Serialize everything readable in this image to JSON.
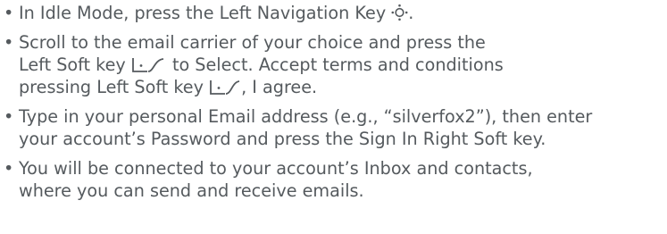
{
  "instructions": [
    {
      "bullet": "•",
      "line1_before": "In Idle Mode, press the Left Navigation Key ",
      "line1_icon": "navigation-key-icon",
      "line1_after": "."
    },
    {
      "bullet": "•",
      "line1": "Scroll to the email carrier of your choice and press the",
      "line2_before": "Left Soft key ",
      "line2_icon": "left-soft-key-icon",
      "line2_after": " to Select. Accept terms and conditions",
      "line3_before": "pressing Left Soft key ",
      "line3_icon": "left-soft-key-icon",
      "line3_after": ", I agree."
    },
    {
      "bullet": "•",
      "line1": "Type in your personal Email address (e.g., “silverfox2”), then enter",
      "line2": "your account’s Password and press the Sign In Right Soft key."
    },
    {
      "bullet": "•",
      "line1": "You will be connected to your account’s Inbox and contacts,",
      "line2": "where you can send and receive emails."
    }
  ],
  "colors": {
    "text": "#555a5e"
  }
}
